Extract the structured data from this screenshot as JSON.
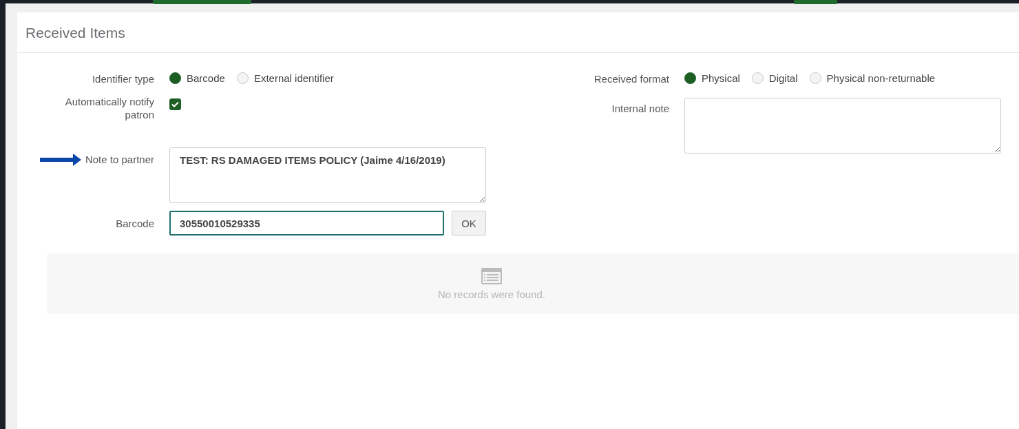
{
  "panel": {
    "title": "Received Items"
  },
  "identifier_type": {
    "label": "Identifier type",
    "options": [
      {
        "label": "Barcode",
        "selected": true
      },
      {
        "label": "External identifier",
        "selected": false
      }
    ]
  },
  "notify_patron": {
    "label": "Automatically notify patron",
    "checked": true
  },
  "received_format": {
    "label": "Received format",
    "options": [
      {
        "label": "Physical",
        "selected": true
      },
      {
        "label": "Digital",
        "selected": false
      },
      {
        "label": "Physical non-returnable",
        "selected": false
      }
    ]
  },
  "internal_note": {
    "label": "Internal note"
  },
  "note_to_partner": {
    "label": "Note to partner",
    "value": "TEST: RS DAMAGED ITEMS POLICY (Jaime 4/16/2019)",
    "highlighted": true
  },
  "barcode": {
    "label": "Barcode",
    "value": "30550010529335",
    "button": "OK"
  },
  "results": {
    "empty_message": "No records were found."
  }
}
